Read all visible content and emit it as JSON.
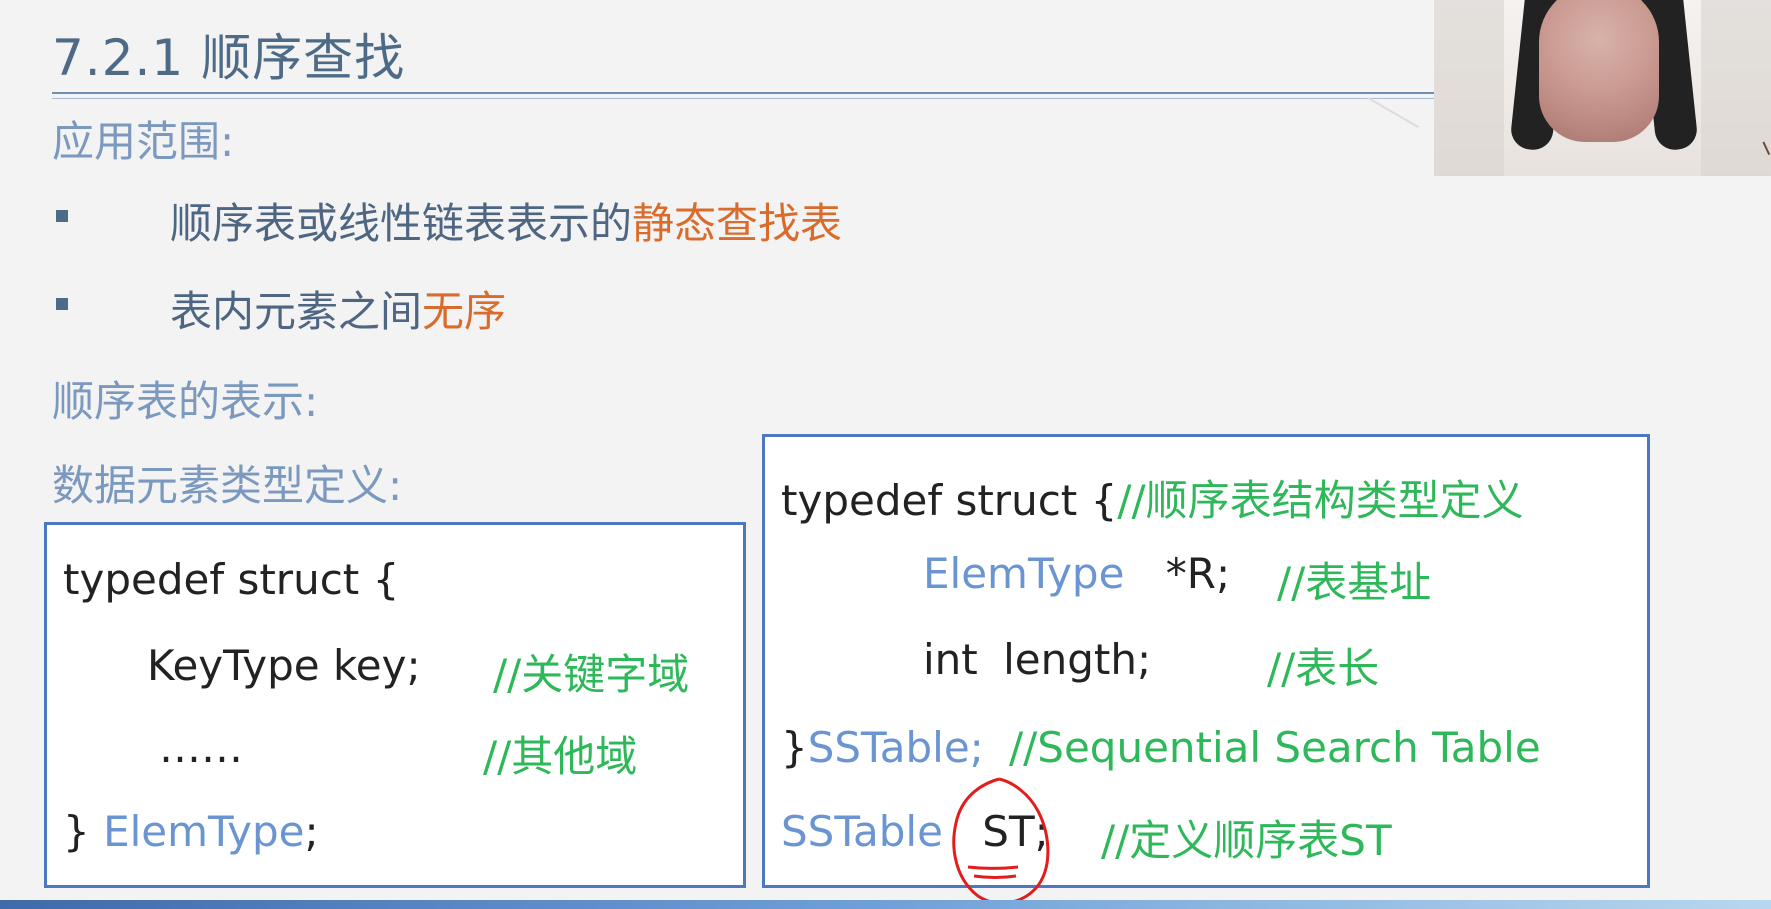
{
  "title": "7.2.1 顺序查找",
  "sections": {
    "scope_label": "应用范围:",
    "sequential_repr_label": "顺序表的表示:",
    "element_type_label": "数据元素类型定义:"
  },
  "bullets": [
    {
      "text_main": "顺序表或线性链表表示的",
      "text_highlight": "静态查找表"
    },
    {
      "text_main": "表内元素之间",
      "text_highlight": "无序"
    }
  ],
  "left_code": {
    "line1": "typedef struct {",
    "line2_type": "KeyType",
    "line2_name": "key;",
    "line2_comment": "//关键字域",
    "line3_dots": "……",
    "line3_comment": "//其他域",
    "line4_brace": "}",
    "line4_type": "ElemType",
    "line4_end": ";"
  },
  "right_code": {
    "line1_code": "typedef struct {",
    "line1_comment": "//顺序表结构类型定义",
    "line2_type": "ElemType",
    "line2_var": "*R;",
    "line2_comment": "//表基址",
    "line3_type": "int",
    "line3_var": "length;",
    "line3_comment": "//表长",
    "line4_brace": "}",
    "line4_type": "SSTable;",
    "line4_comment": "//Sequential Search Table",
    "line5_type": "SSTable",
    "line5_var": "ST;",
    "line5_comment": "//定义顺序表ST"
  },
  "colors": {
    "title": "#4d6a86",
    "section_label": "#7b98bf",
    "highlight": "#d96c2c",
    "code_type": "#6a95d2",
    "code_comment": "#2eb85a",
    "box_border": "#4c78c0",
    "annotation": "#e31c1c"
  },
  "icons": {
    "bullet": "square-bullet-icon",
    "annotation": "red-circle-annotation-icon",
    "webcam": "webcam-video-icon"
  }
}
